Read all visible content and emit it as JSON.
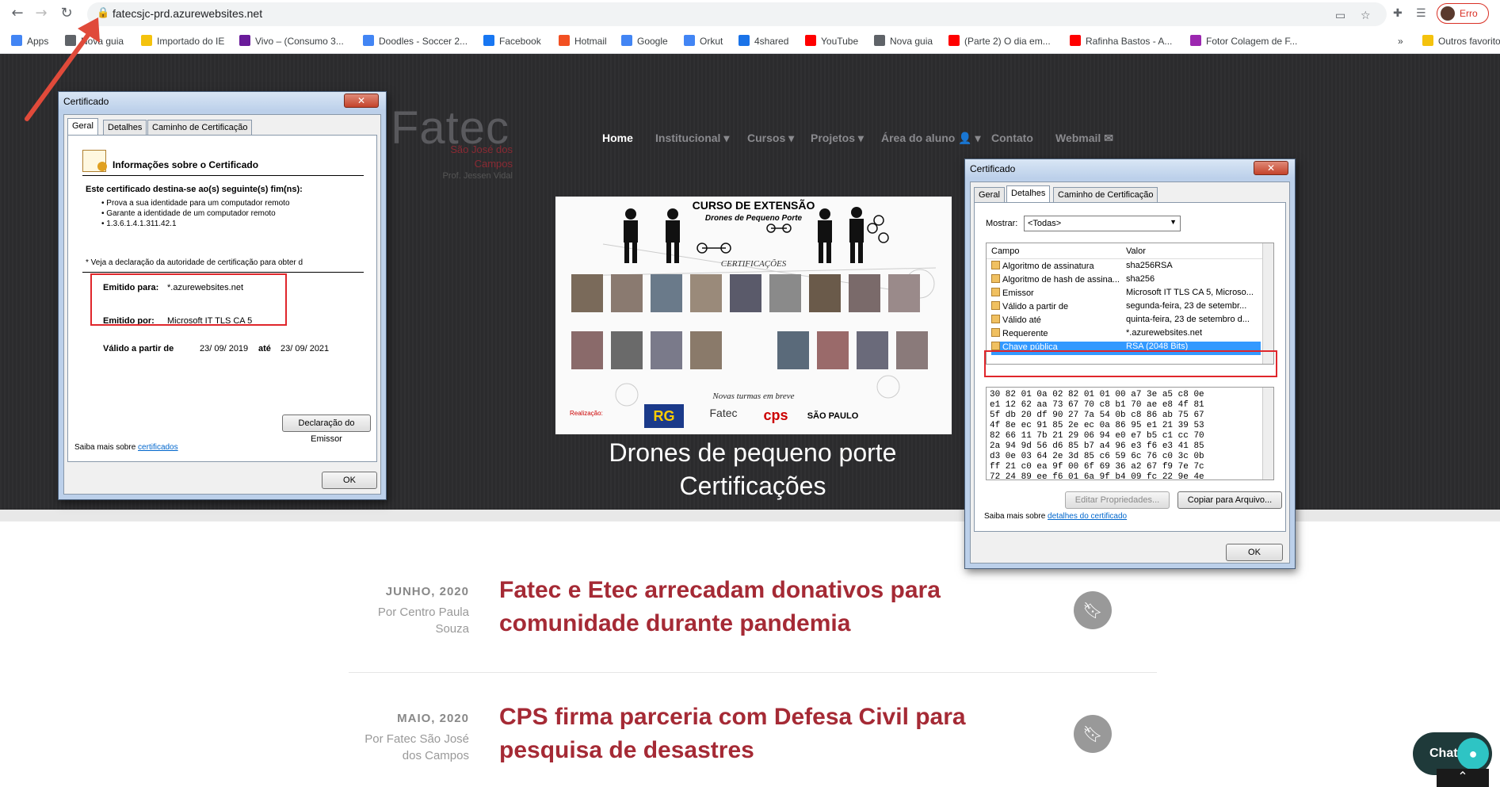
{
  "browser": {
    "url": "fatecsjc-prd.azurewebsites.net",
    "profile_label": "Erro",
    "bookmarks": [
      {
        "label": "Apps",
        "color": "#4285f4"
      },
      {
        "label": "Nova guia",
        "color": "#5f6368"
      },
      {
        "label": "Importado do IE",
        "color": "#f4c20d"
      },
      {
        "label": "Vivo – (Consumo 3...",
        "color": "#6a1b9a"
      },
      {
        "label": "Doodles - Soccer 2...",
        "color": "#4285f4"
      },
      {
        "label": "Facebook",
        "color": "#1877f2"
      },
      {
        "label": "Hotmail",
        "color": "#f25022"
      },
      {
        "label": "Google",
        "color": "#4285f4"
      },
      {
        "label": "Orkut",
        "color": "#4285f4"
      },
      {
        "label": "4shared",
        "color": "#1a73e8"
      },
      {
        "label": "YouTube",
        "color": "#ff0000"
      },
      {
        "label": "Nova guia",
        "color": "#5f6368"
      },
      {
        "label": "(Parte 2) O dia em...",
        "color": "#ff0000"
      },
      {
        "label": "Rafinha Bastos - A...",
        "color": "#ff0000"
      },
      {
        "label": "Fotor Colagem de F...",
        "color": "#9c27b0"
      },
      {
        "label": "»",
        "color": "#ffffff"
      },
      {
        "label": "Outros favoritos",
        "color": "#f4c20d"
      }
    ]
  },
  "site": {
    "logo": "Fatec",
    "logo_sub1": "São José dos",
    "logo_sub2": "Campos",
    "logo_sub3": "Prof. Jessen Vidal",
    "nav": [
      {
        "label": "Home",
        "active": true
      },
      {
        "label": "Institucional ▾"
      },
      {
        "label": "Cursos ▾"
      },
      {
        "label": "Projetos ▾"
      },
      {
        "label": "Área do aluno 👤 ▾"
      },
      {
        "label": "Contato"
      },
      {
        "label": "Webmail ✉"
      }
    ],
    "hero": {
      "title": "CURSO DE EXTENSÃO",
      "subtitle": "Drones de Pequeno Porte",
      "cert": "CERTIFICAÇÕES",
      "novas": "Novas turmas em breve",
      "realizacao": "Realização:",
      "caption_line1": "Drones de pequeno porte",
      "caption_line2": "Certificações"
    },
    "posts": [
      {
        "date": "JUNHO, 2020",
        "author": "Por Centro Paula Souza",
        "title": "Fatec e Etec arrecadam donativos para comunidade durante pandemia"
      },
      {
        "date": "MAIO, 2020",
        "author": "Por Fatec São José dos Campos",
        "title": "CPS firma parceria com Defesa Civil para pesquisa de desastres"
      }
    ],
    "chat_label": "Chat"
  },
  "cert_general": {
    "window_title": "Certificado",
    "tabs": [
      "Geral",
      "Detalhes",
      "Caminho de Certificação"
    ],
    "info_heading": "Informações sobre o Certificado",
    "purpose_heading": "Este certificado destina-se ao(s) seguinte(s) fim(ns):",
    "purposes": [
      "• Prova a sua identidade para um computador remoto",
      "• Garante a identidade de um computador remoto",
      "• 1.3.6.1.4.1.311.42.1"
    ],
    "note": "* Veja a declaração da autoridade de certificação para obter d",
    "issued_to_label": "Emitido para:",
    "issued_to_value": "*.azurewebsites.net",
    "issued_by_label": "Emitido por:",
    "issued_by_value": "Microsoft IT TLS CA 5",
    "valid_from_label": "Válido a partir de",
    "valid_from": "23/ 09/ 2019",
    "valid_to_label": "até",
    "valid_to": "23/ 09/ 2021",
    "issuer_stmt_button": "Declaração do Emissor",
    "learn_more": "Saiba mais sobre ",
    "learn_more_link": "certificados",
    "ok": "OK"
  },
  "cert_details": {
    "window_title": "Certificado",
    "tabs": [
      "Geral",
      "Detalhes",
      "Caminho de Certificação"
    ],
    "show_label": "Mostrar:",
    "show_value": "<Todas>",
    "col_field": "Campo",
    "col_value": "Valor",
    "rows": [
      {
        "field": "Algoritmo de assinatura",
        "value": "sha256RSA"
      },
      {
        "field": "Algoritmo de hash de assina...",
        "value": "sha256"
      },
      {
        "field": "Emissor",
        "value": "Microsoft IT TLS CA 5, Microso..."
      },
      {
        "field": "Válido a partir de",
        "value": "segunda-feira, 23 de setembr..."
      },
      {
        "field": "Válido até",
        "value": "quinta-feira, 23 de setembro d..."
      },
      {
        "field": "Requerente",
        "value": "*.azurewebsites.net"
      },
      {
        "field": "Chave pública",
        "value": "RSA (2048 Bits)",
        "selected": true
      }
    ],
    "hex": [
      "30 82 01 0a 02 82 01 01 00 a7 3e a5 c8 0e",
      "e1 12 62 aa 73 67 70 c8 b1 70 ae e8 4f 81",
      "5f db 20 df 90 27 7a 54 0b c8 86 ab 75 67",
      "4f 8e ec 91 85 2e ec 0a 86 95 e1 21 39 53",
      "82 66 11 7b 21 29 06 94 e0 e7 b5 c1 cc 70",
      "2a 94 9d 56 d6 85 b7 a4 96 e3 f6 e3 41 85",
      "d3 0e 03 64 2e 3d 85 c6 59 6c 76 c0 3c 0b",
      "ff 21 c0 ea 9f 00 6f 69 36 a2 67 f9 7e 7c",
      "72 24 89 ee f6 01 6a 9f b4 09 fc 22 9e 4e"
    ],
    "edit_button": "Editar Propriedades...",
    "copy_button": "Copiar para Arquivo...",
    "learn_more": "Saiba mais sobre ",
    "learn_more_link": "detalhes do certificado",
    "ok": "OK"
  }
}
